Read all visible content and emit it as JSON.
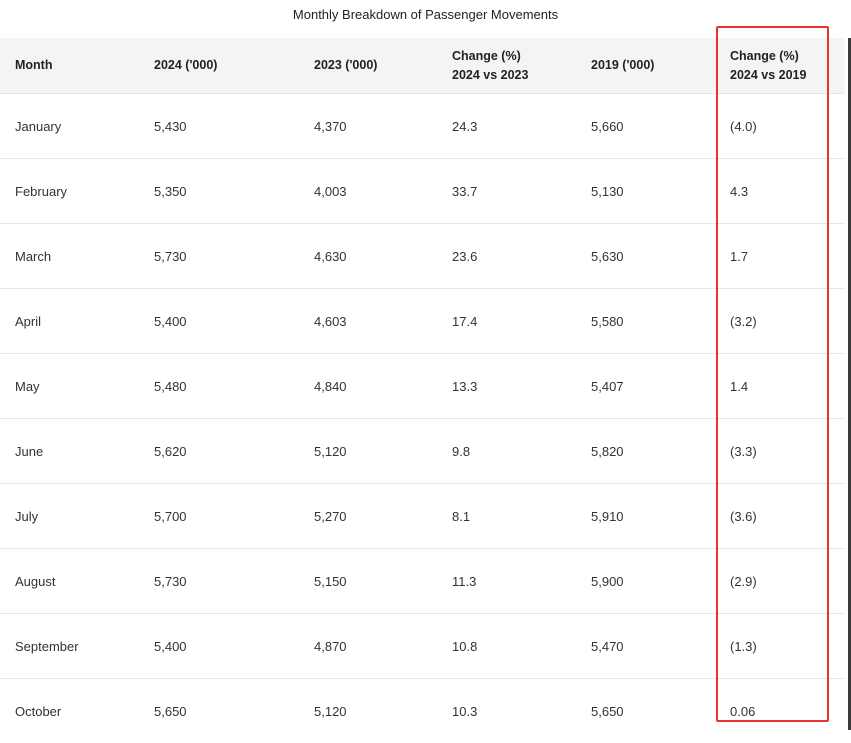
{
  "title": "Monthly Breakdown of Passenger Movements",
  "columns": [
    {
      "line1": "Month",
      "line2": ""
    },
    {
      "line1": "2024 ('000)",
      "line2": ""
    },
    {
      "line1": "2023 ('000)",
      "line2": ""
    },
    {
      "line1": "Change (%)",
      "line2": "2024 vs 2023"
    },
    {
      "line1": "2019 ('000)",
      "line2": ""
    },
    {
      "line1": "Change (%)",
      "line2": "2024 vs 2019"
    }
  ],
  "rows": [
    [
      "January",
      "5,430",
      "4,370",
      "24.3",
      "5,660",
      "(4.0)"
    ],
    [
      "February",
      "5,350",
      "4,003",
      "33.7",
      "5,130",
      "4.3"
    ],
    [
      "March",
      "5,730",
      "4,630",
      "23.6",
      "5,630",
      "1.7"
    ],
    [
      "April",
      "5,400",
      "4,603",
      "17.4",
      "5,580",
      "(3.2)"
    ],
    [
      "May",
      "5,480",
      "4,840",
      "13.3",
      "5,407",
      "1.4"
    ],
    [
      "June",
      "5,620",
      "5,120",
      "9.8",
      "5,820",
      "(3.3)"
    ],
    [
      "July",
      "5,700",
      "5,270",
      "8.1",
      "5,910",
      "(3.6)"
    ],
    [
      "August",
      "5,730",
      "5,150",
      "11.3",
      "5,900",
      "(2.9)"
    ],
    [
      "September",
      "5,400",
      "4,870",
      "10.8",
      "5,470",
      "(1.3)"
    ],
    [
      "October",
      "5,650",
      "5,120",
      "10.3",
      "5,650",
      "0.06"
    ]
  ],
  "colors": {
    "highlight": "#e8332f",
    "header_bg": "#f4f4f4",
    "row_border": "#e8e8e8"
  },
  "chart_data": {
    "type": "table",
    "title": "Monthly Breakdown of Passenger Movements",
    "columns": [
      "Month",
      "2024 ('000)",
      "2023 ('000)",
      "Change (%) 2024 vs 2023",
      "2019 ('000)",
      "Change (%) 2024 vs 2019"
    ],
    "rows": [
      [
        "January",
        5430,
        4370,
        24.3,
        5660,
        -4.0
      ],
      [
        "February",
        5350,
        4003,
        33.7,
        5130,
        4.3
      ],
      [
        "March",
        5730,
        4630,
        23.6,
        5630,
        1.7
      ],
      [
        "April",
        5400,
        4603,
        17.4,
        5580,
        -3.2
      ],
      [
        "May",
        5480,
        4840,
        13.3,
        5407,
        1.4
      ],
      [
        "June",
        5620,
        5120,
        9.8,
        5820,
        -3.3
      ],
      [
        "July",
        5700,
        5270,
        8.1,
        5910,
        -3.6
      ],
      [
        "August",
        5730,
        5150,
        11.3,
        5900,
        -2.9
      ],
      [
        "September",
        5400,
        4870,
        10.8,
        5470,
        -1.3
      ],
      [
        "October",
        5650,
        5120,
        10.3,
        5650,
        0.06
      ]
    ],
    "highlighted_column": "Change (%) 2024 vs 2019"
  }
}
